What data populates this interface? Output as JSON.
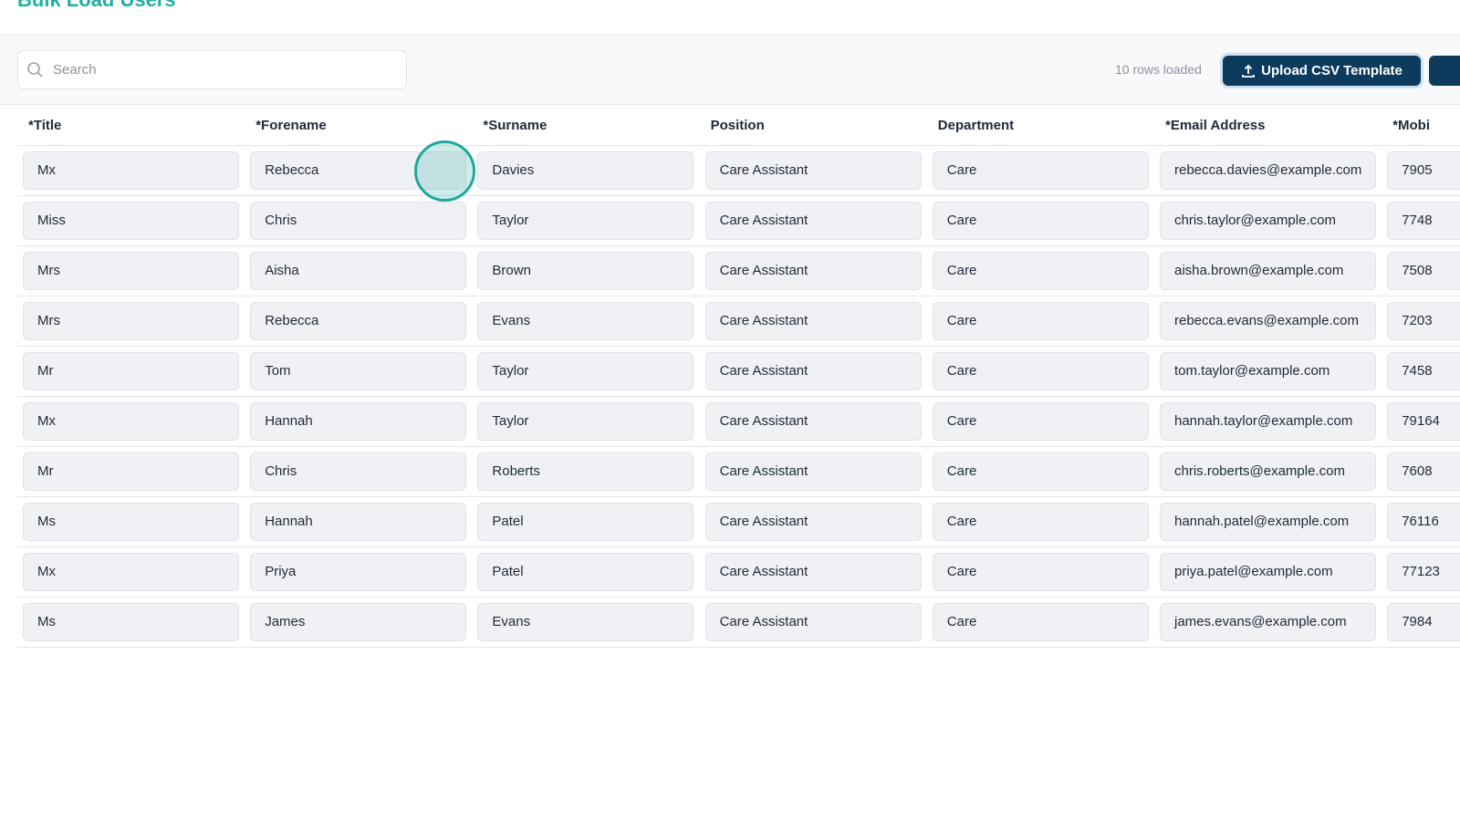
{
  "page": {
    "title": "Bulk Load Users"
  },
  "toolbar": {
    "search_placeholder": "Search",
    "rows_loaded": "10 rows loaded",
    "upload_label": "Upload CSV Template"
  },
  "columns": [
    "*Title",
    "*Forename",
    "*Surname",
    "Position",
    "Department",
    "*Email Address",
    "*Mobi"
  ],
  "rows": [
    [
      "Mx",
      "Rebecca",
      "Davies",
      "Care Assistant",
      "Care",
      "rebecca.davies@example.com",
      "7905"
    ],
    [
      "Miss",
      "Chris",
      "Taylor",
      "Care Assistant",
      "Care",
      "chris.taylor@example.com",
      "7748"
    ],
    [
      "Mrs",
      "Aisha",
      "Brown",
      "Care Assistant",
      "Care",
      "aisha.brown@example.com",
      "7508"
    ],
    [
      "Mrs",
      "Rebecca",
      "Evans",
      "Care Assistant",
      "Care",
      "rebecca.evans@example.com",
      "7203"
    ],
    [
      "Mr",
      "Tom",
      "Taylor",
      "Care Assistant",
      "Care",
      "tom.taylor@example.com",
      "7458"
    ],
    [
      "Mx",
      "Hannah",
      "Taylor",
      "Care Assistant",
      "Care",
      "hannah.taylor@example.com",
      "79164"
    ],
    [
      "Mr",
      "Chris",
      "Roberts",
      "Care Assistant",
      "Care",
      "chris.roberts@example.com",
      "7608"
    ],
    [
      "Ms",
      "Hannah",
      "Patel",
      "Care Assistant",
      "Care",
      "hannah.patel@example.com",
      "76116"
    ],
    [
      "Mx",
      "Priya",
      "Patel",
      "Care Assistant",
      "Care",
      "priya.patel@example.com",
      "77123"
    ],
    [
      "Ms",
      "James",
      "Evans",
      "Care Assistant",
      "Care",
      "james.evans@example.com",
      "7984"
    ]
  ],
  "colors": {
    "accent": "#1fb0a3",
    "primary_button": "#0d3b5e"
  }
}
